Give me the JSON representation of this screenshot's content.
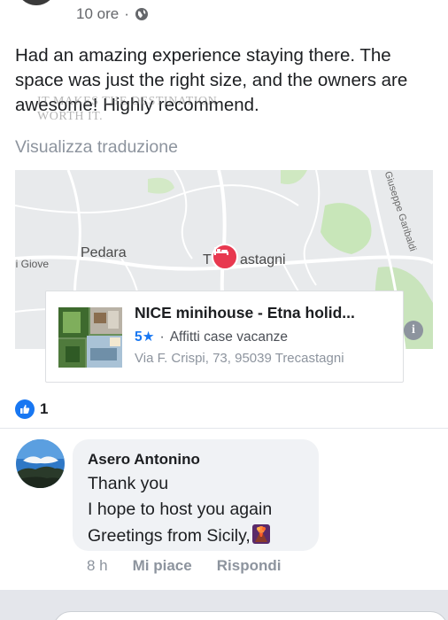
{
  "post": {
    "time": "10 ore",
    "separator": "·",
    "text": "Had an amazing experience staying there. The space was just the right size, and the owners are awesome! Highly recommend.",
    "translate_label": "Visualizza traduzione"
  },
  "watermark": {
    "line1": "IT MAKES THE DESTINATION",
    "line2": "WORTH IT."
  },
  "map": {
    "labels": {
      "pedara": "Pedara",
      "trecastagni_left": "T",
      "trecastagni_right": "astagni",
      "giove": "di Giove",
      "street": "Giuseppe Garibaldi"
    }
  },
  "place": {
    "name": "NICE minihouse - Etna holid...",
    "rating": "5★",
    "dot": "·",
    "category": "Affitti case vacanze",
    "address": "Via F. Crispi, 73, 95039 Trecastagni"
  },
  "reactions": {
    "count": "1"
  },
  "comment": {
    "author": "Asero Antonino",
    "lines": [
      "Thank you",
      "I hope to host  you again",
      "Greetings from Sicily,"
    ],
    "time": "8 h",
    "like_label": "Mi piace",
    "reply_label": "Rispondi"
  },
  "colors": {
    "accent": "#1877f2",
    "pin": "#e8384f",
    "muted": "#8d949e"
  },
  "icons": {
    "globe": "globe-icon",
    "bed": "bed-icon",
    "info": "info-icon",
    "like": "thumbs-up-icon",
    "emoji": "volcano-emoji-icon"
  }
}
